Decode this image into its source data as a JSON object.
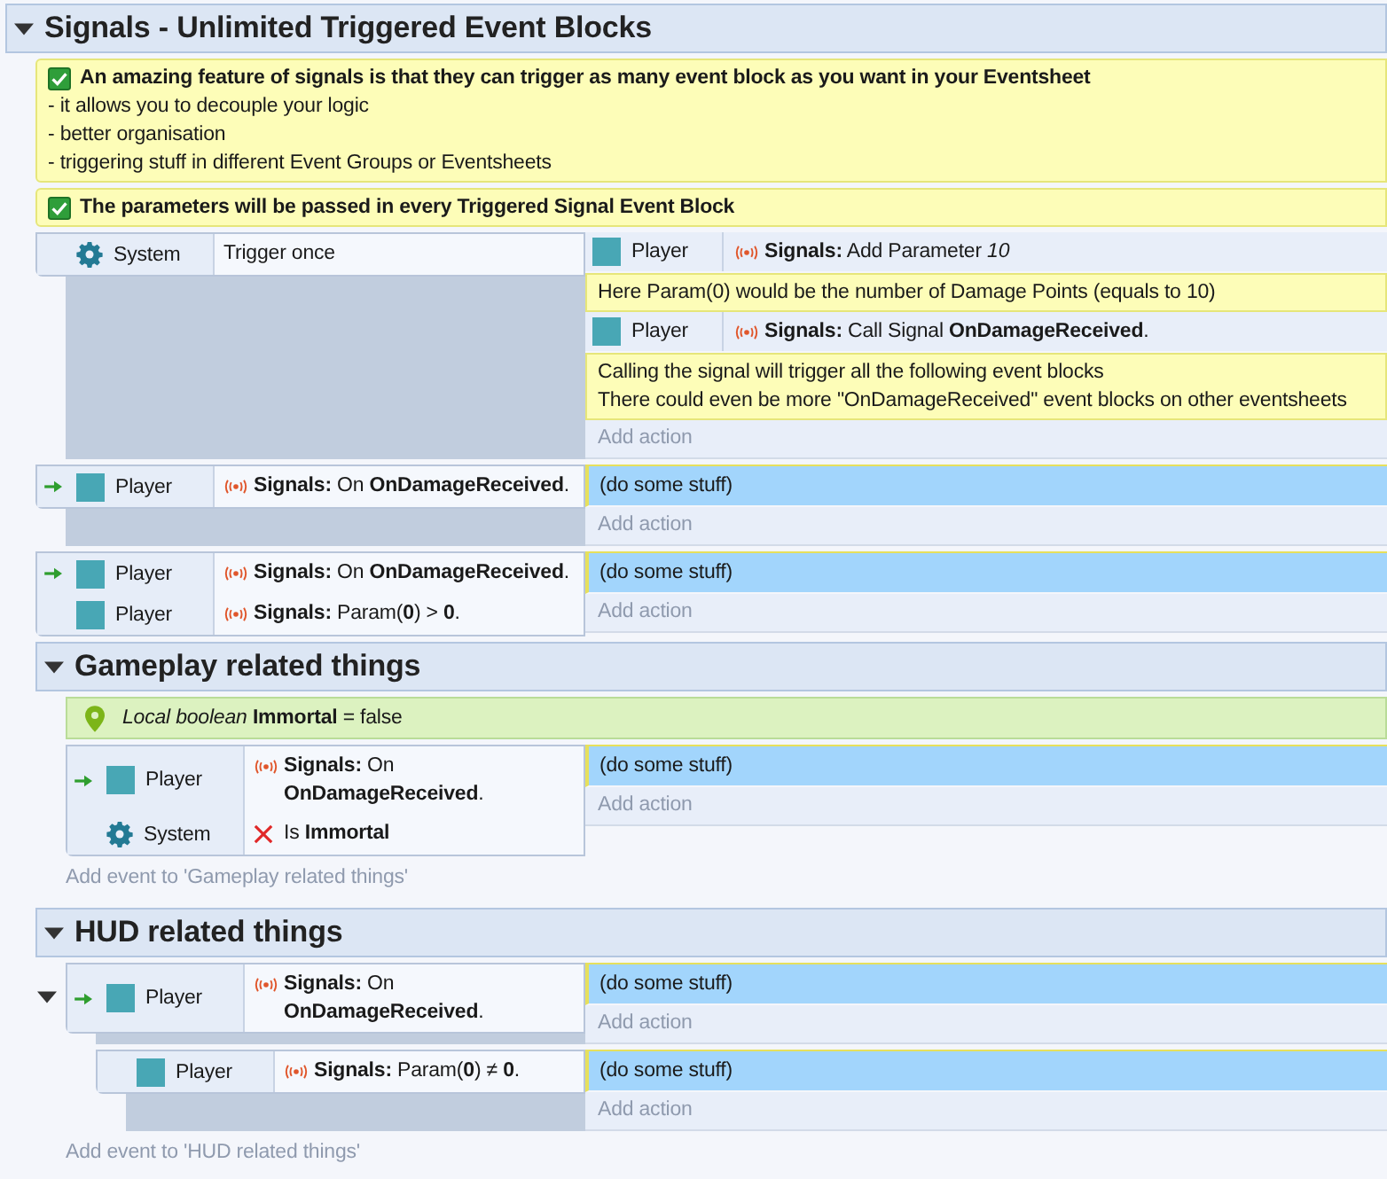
{
  "groups": [
    {
      "kind": "group",
      "title": "Signals - Unlimited Triggered Event Blocks",
      "expanded": true,
      "items": [
        {
          "kind": "comment",
          "checked": true,
          "heading": "An amazing feature of signals is that they can trigger as many event block as you want in your Eventsheet",
          "lines": [
            "- it allows you to decouple your logic",
            "- better organisation",
            "- triggering stuff in different Event Groups or Eventsheets"
          ]
        },
        {
          "kind": "comment",
          "checked": true,
          "heading": "The parameters will be passed in every Triggered Signal Event Block"
        },
        {
          "kind": "event",
          "trigger": false,
          "conditions": [
            {
              "kind": "system",
              "object": "System",
              "text": "Trigger once",
              "inverted": false
            }
          ],
          "actions": [
            {
              "kind": "action",
              "selected": false,
              "object": "Player",
              "text": "**Signals:** Add Parameter *10*"
            },
            {
              "kind": "comment",
              "lines": [
                "Here Param(0) would be the number of Damage Points (equals to 10)"
              ]
            },
            {
              "kind": "action",
              "selected": false,
              "object": "Player",
              "text": "**Signals:** Call Signal **OnDamageReceived**."
            },
            {
              "kind": "comment",
              "lines": [
                "Calling the signal will trigger all the following event blocks",
                "There could even be more \"OnDamageReceived\" event blocks on other eventsheets"
              ]
            }
          ],
          "add_action": "Add action"
        },
        {
          "kind": "event",
          "trigger": true,
          "conditions": [
            {
              "kind": "object",
              "object": "Player",
              "text": "**Signals:** On **OnDamageReceived**.",
              "inverted": false
            }
          ],
          "actions": [
            {
              "kind": "action",
              "selected": true,
              "text": "(do some stuff)"
            }
          ],
          "add_action": "Add action"
        },
        {
          "kind": "event",
          "trigger": true,
          "conditions": [
            {
              "kind": "object",
              "object": "Player",
              "text": "**Signals:** On **OnDamageReceived**.",
              "inverted": false
            },
            {
              "kind": "object",
              "object": "Player",
              "text": "**Signals:** Param(**0**) > **0**.",
              "inverted": false
            }
          ],
          "actions": [
            {
              "kind": "action",
              "selected": true,
              "text": "(do some stuff)"
            }
          ],
          "add_action": "Add action"
        },
        {
          "kind": "group",
          "title": "Gameplay related things",
          "expanded": true,
          "items": [
            {
              "kind": "variable",
              "text": "*Local boolean* **Immortal** = false"
            },
            {
              "kind": "event",
              "trigger": true,
              "conditions": [
                {
                  "kind": "object",
                  "object": "Player",
                  "text": "**Signals:** On **OnDamageReceived**.",
                  "inverted": false
                },
                {
                  "kind": "system",
                  "object": "System",
                  "text": "Is **Immortal**",
                  "inverted": true
                }
              ],
              "actions": [
                {
                  "kind": "action",
                  "selected": true,
                  "text": "(do some stuff)"
                }
              ],
              "add_action": "Add action"
            }
          ],
          "add_event": "Add event to 'Gameplay related things'"
        },
        {
          "kind": "group",
          "title": "HUD related things",
          "expanded": true,
          "items": [
            {
              "kind": "event",
              "trigger": true,
              "expanded": true,
              "conditions": [
                {
                  "kind": "object",
                  "object": "Player",
                  "text": "**Signals:** On **OnDamageReceived**.",
                  "inverted": false
                }
              ],
              "actions": [
                {
                  "kind": "action",
                  "selected": true,
                  "text": "(do some stuff)"
                }
              ],
              "add_action": "Add action",
              "children": [
                {
                  "kind": "event",
                  "trigger": false,
                  "conditions": [
                    {
                      "kind": "object",
                      "object": "Player",
                      "text": "**Signals:** Param(**0**) ≠ **0**.",
                      "inverted": false
                    }
                  ],
                  "actions": [
                    {
                      "kind": "action",
                      "selected": true,
                      "text": "(do some stuff)"
                    }
                  ],
                  "add_action": "Add action"
                }
              ]
            }
          ],
          "add_event": "Add event to 'HUD related things'"
        }
      ]
    }
  ]
}
